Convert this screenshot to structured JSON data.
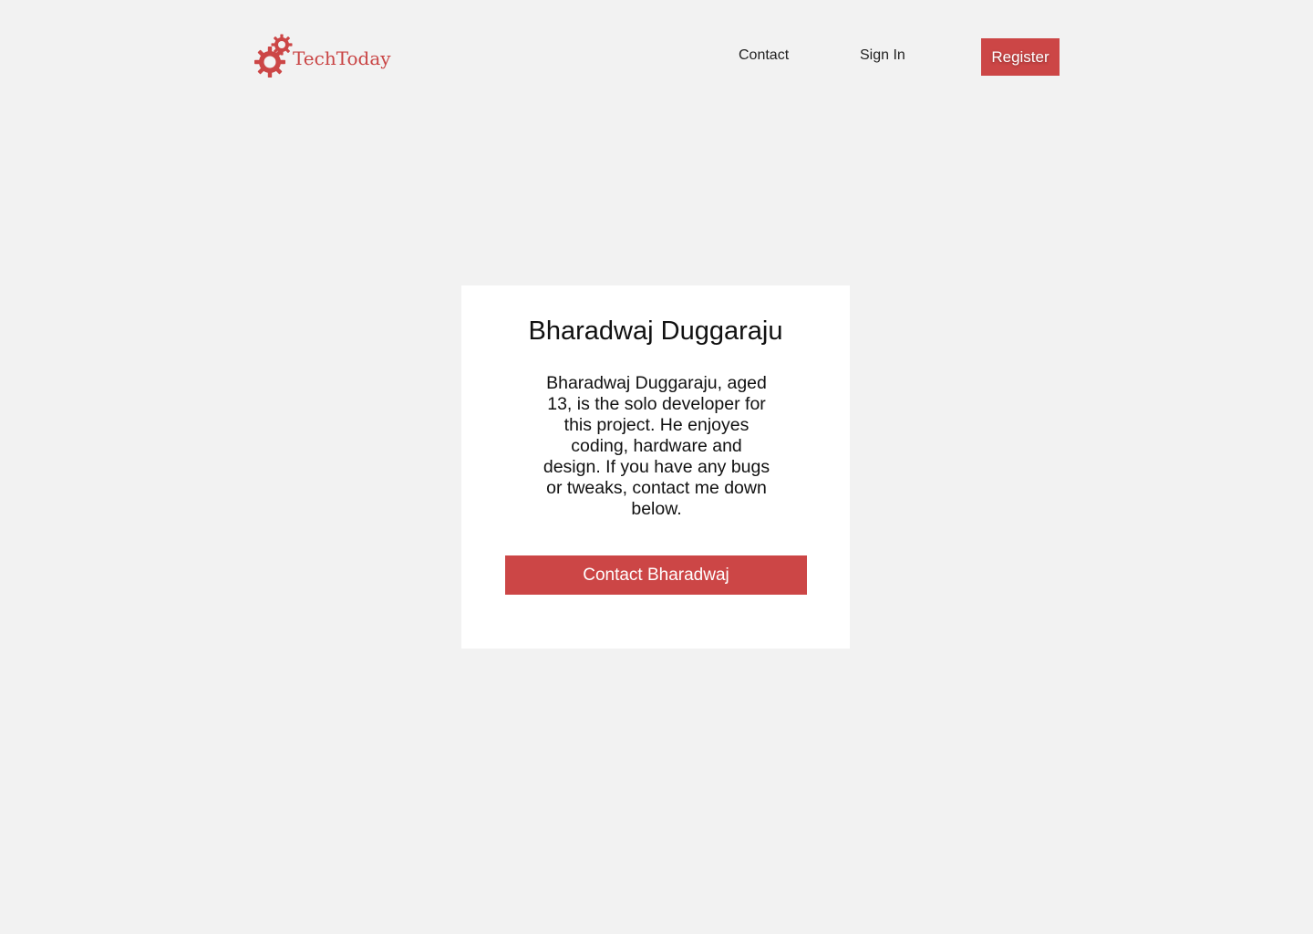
{
  "header": {
    "logo_text": "TechToday",
    "nav": {
      "contact_label": "Contact",
      "signin_label": "Sign In",
      "register_label": "Register"
    }
  },
  "card": {
    "title": "Bharadwaj Duggaraju",
    "body": "Bharadwaj Duggaraju, aged 13, is the solo developer for this project. He enjoyes coding, hardware and design. If you have any bugs or tweaks, contact me down below.",
    "button_label": "Contact Bharadwaj"
  },
  "colors": {
    "background": "#f2f2f2",
    "accent": "#cc4646",
    "card_background": "#ffffff"
  },
  "icons": {
    "logo": "gears-icon"
  }
}
